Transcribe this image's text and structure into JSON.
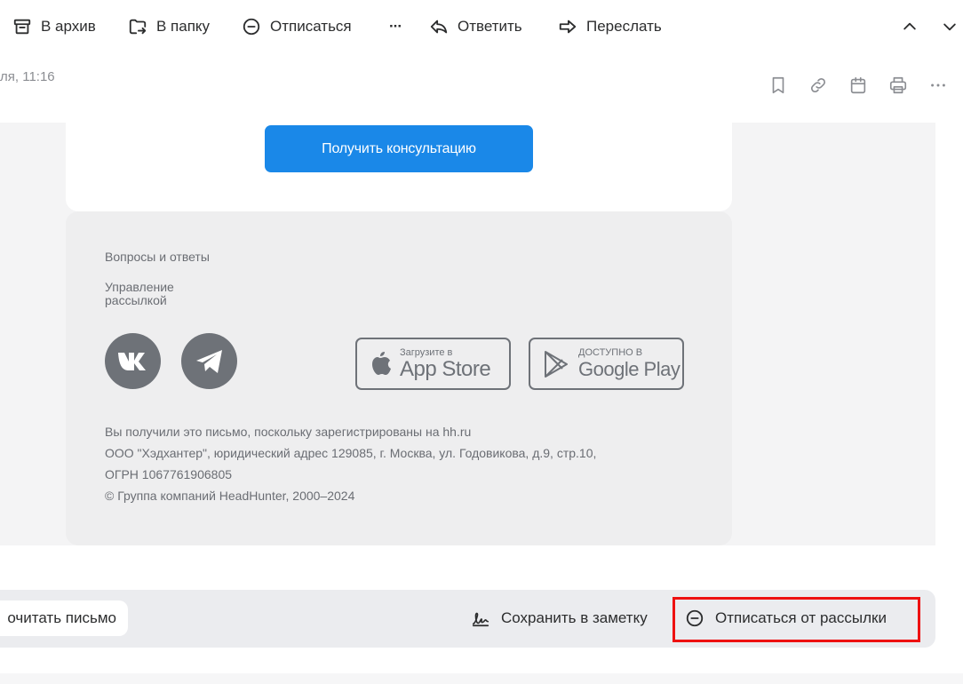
{
  "toolbar": {
    "archive_label": "В архив",
    "move_label": "В папку",
    "unsubscribe_label": "Отписаться",
    "more_label": "···",
    "reply_label": "Ответить",
    "forward_label": "Переслать"
  },
  "message": {
    "date": "ля, 11:16"
  },
  "letter": {
    "cta_label": "Получить консультацию",
    "faq_link": "Вопросы и ответы",
    "manage_line1": "Управление",
    "manage_line2": "рассылкой",
    "appstore_small": "Загрузите в",
    "appstore_big": "App Store",
    "googleplay_small": "ДОСТУПНО В",
    "googleplay_big": "Google Play",
    "legal_line1": "Вы получили это письмо, поскольку зарегистрированы на hh.ru",
    "legal_line2": "ООО \"Хэдхантер\", юридический адрес 129085, г. Москва, ул. Годовикова, д.9, стр.10,",
    "legal_line3": "ОГРН 1067761906805",
    "legal_line4": "© Группа компаний HeadHunter, 2000–2024"
  },
  "bottom": {
    "read_label": "очитать письмо",
    "save_note_label": "Сохранить в заметку",
    "unsubscribe_label": "Отписаться от рассылки"
  },
  "colors": {
    "accent_blue": "#1a88e8",
    "highlight_red": "#ee1111"
  }
}
